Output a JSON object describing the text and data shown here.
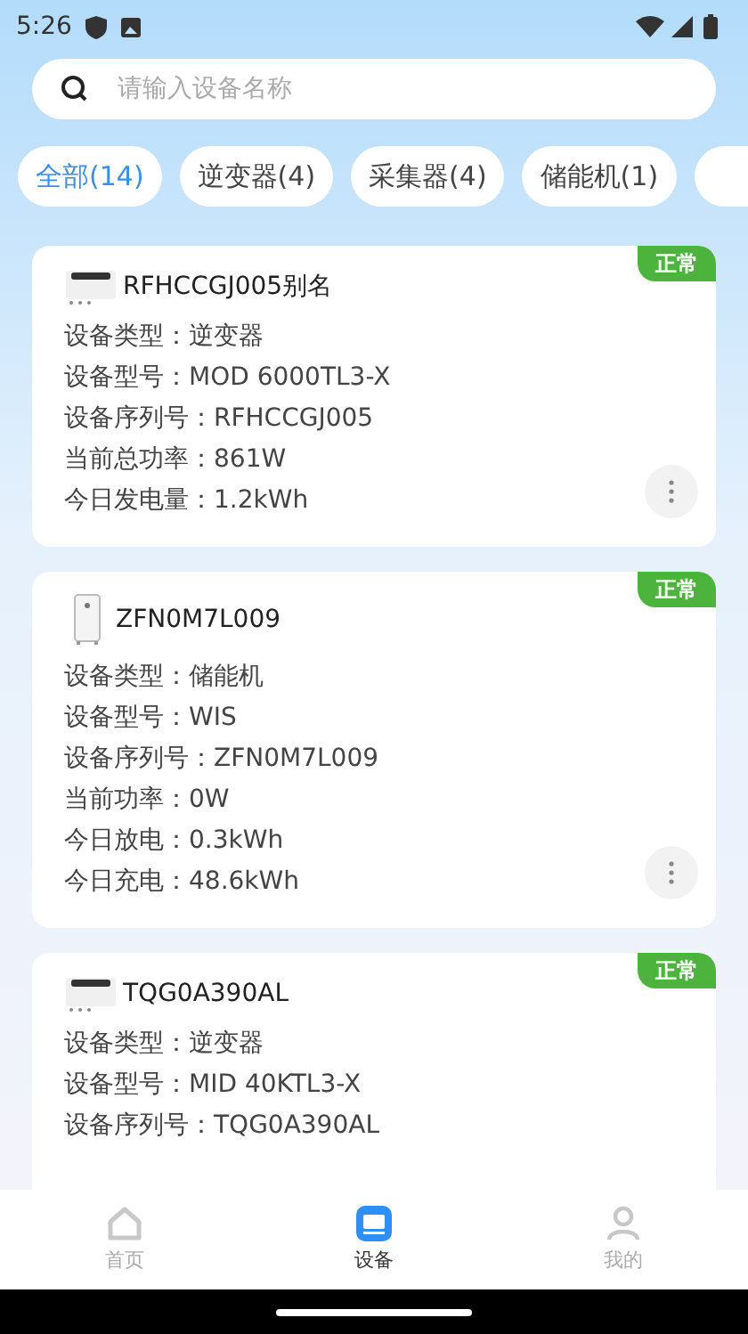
{
  "status_bar": {
    "time": "5:26"
  },
  "search": {
    "placeholder": "请输入设备名称"
  },
  "tabs": [
    {
      "label": "全部(14)",
      "selected": true
    },
    {
      "label": "逆变器(4)",
      "selected": false
    },
    {
      "label": "采集器(4)",
      "selected": false
    },
    {
      "label": "储能机(1)",
      "selected": false
    }
  ],
  "devices": [
    {
      "kind": "inverter",
      "name": "RFHCCGJ005别名",
      "status": "正常",
      "fields": [
        "设备类型：逆变器",
        "设备型号：MOD 6000TL3-X",
        "设备序列号：RFHCCGJ005",
        "当前总功率：861W",
        "今日发电量：1.2kWh"
      ]
    },
    {
      "kind": "storage",
      "name": "ZFN0M7L009",
      "status": "正常",
      "fields": [
        "设备类型：储能机",
        "设备型号：WIS",
        "设备序列号：ZFN0M7L009",
        "当前功率：0W",
        "今日放电：0.3kWh",
        "今日充电：48.6kWh"
      ]
    },
    {
      "kind": "inverter",
      "name": "TQG0A390AL",
      "status": "正常",
      "fields": [
        "设备类型：逆变器",
        "设备型号：MID 40KTL3-X",
        "设备序列号：TQG0A390AL"
      ]
    }
  ],
  "nav": [
    {
      "label": "首页",
      "selected": false
    },
    {
      "label": "设备",
      "selected": true
    },
    {
      "label": "我的",
      "selected": false
    }
  ]
}
